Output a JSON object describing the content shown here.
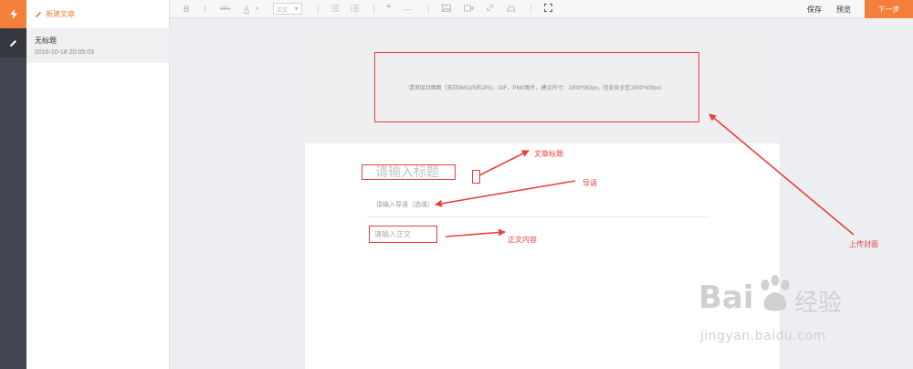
{
  "sidebar": {
    "new_article": "新建文章",
    "articles": [
      {
        "title": "无标题",
        "date": "2016-10-18 20:05:03"
      }
    ]
  },
  "toolbar": {
    "bold": "B",
    "italic": "I",
    "strike": "abc",
    "font_color": "A",
    "paragraph_format": "正文",
    "save_label": "保存",
    "preview_label": "预览",
    "next_label": "下一步"
  },
  "editor": {
    "cover_hint": "请添加封面图（支持5M以内的JPG、GIF、PNG图片，建议尺寸：1000*562px，信息安全区1000*400px）",
    "title_placeholder": "请输入标题",
    "intro_placeholder": "请输入导语（选填）",
    "body_placeholder": "请输入正文"
  },
  "annotations": {
    "article_title": "文章标题",
    "intro": "导语",
    "body": "正文内容",
    "upload_cover": "上传封面"
  },
  "watermark": {
    "brand": "Bai",
    "brand2": "du",
    "product": "经验",
    "url": "jingyan.baidu.com"
  },
  "colors": {
    "accent": "#f37f3a",
    "annotation": "#e8413e",
    "rail": "#41454f"
  }
}
